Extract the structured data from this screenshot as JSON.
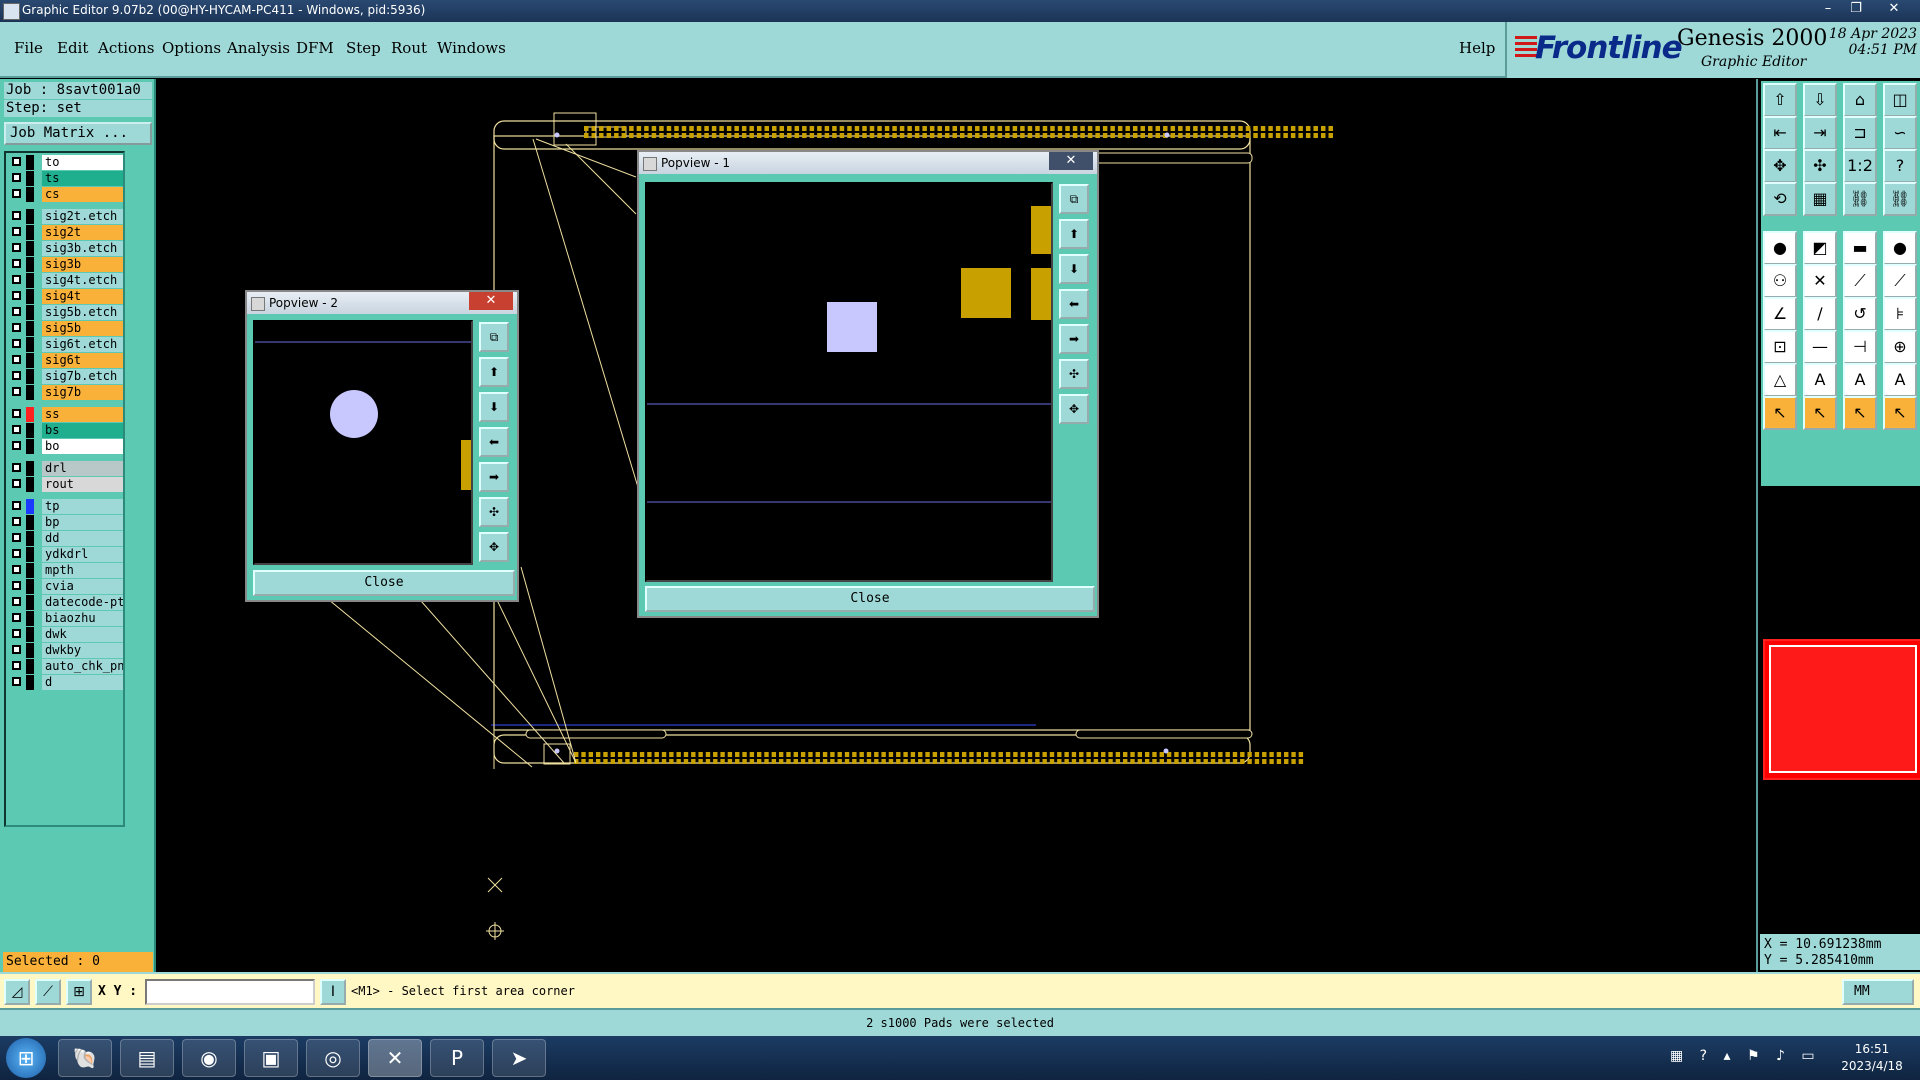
{
  "window": {
    "title": "Graphic Editor 9.07b2 (00@HY-HYCAM-PC411 - Windows, pid:5936)",
    "minimize": "–",
    "restore": "❐",
    "close": "✕"
  },
  "menu": [
    "File",
    "Edit",
    "Actions",
    "Options",
    "Analysis",
    "DFM",
    "Step",
    "Rout",
    "Windows"
  ],
  "help": "Help",
  "brand": {
    "logo": "Frontline",
    "product": "Genesis 2000",
    "subtitle": "Graphic Editor",
    "date": "18 Apr 2023",
    "time": "04:51 PM"
  },
  "job": {
    "label": "Job : 8savt001a0",
    "step": "Step: set",
    "matrix_button": "Job Matrix ..."
  },
  "layers": [
    {
      "name": "to",
      "color": "#ffffff",
      "swatch": "#000000"
    },
    {
      "name": "ts",
      "color": "#1fae8e",
      "swatch": "#000000"
    },
    {
      "name": "cs",
      "color": "#f9b13a",
      "swatch": "#000000"
    },
    {
      "name": "sig2t.etch",
      "color": "#9ed9d8",
      "swatch": "#000000"
    },
    {
      "name": "sig2t",
      "color": "#f9b13a",
      "swatch": "#000000"
    },
    {
      "name": "sig3b.etch",
      "color": "#9ed9d8",
      "swatch": "#000000"
    },
    {
      "name": "sig3b",
      "color": "#f9b13a",
      "swatch": "#000000"
    },
    {
      "name": "sig4t.etch",
      "color": "#9ed9d8",
      "swatch": "#000000"
    },
    {
      "name": "sig4t",
      "color": "#f9b13a",
      "swatch": "#000000"
    },
    {
      "name": "sig5b.etch",
      "color": "#9ed9d8",
      "swatch": "#000000"
    },
    {
      "name": "sig5b",
      "color": "#f9b13a",
      "swatch": "#000000"
    },
    {
      "name": "sig6t.etch",
      "color": "#9ed9d8",
      "swatch": "#000000"
    },
    {
      "name": "sig6t",
      "color": "#f9b13a",
      "swatch": "#000000"
    },
    {
      "name": "sig7b.etch",
      "color": "#9ed9d8",
      "swatch": "#000000"
    },
    {
      "name": "sig7b",
      "color": "#f9b13a",
      "swatch": "#000000"
    },
    {
      "name": "ss",
      "color": "#f9b13a",
      "swatch": "#ff2020"
    },
    {
      "name": "bs",
      "color": "#1fae8e",
      "swatch": "#000000"
    },
    {
      "name": "bo",
      "color": "#ffffff",
      "swatch": "#000000"
    },
    {
      "name": "drl",
      "color": "#b8c8c8",
      "swatch": "#000000"
    },
    {
      "name": "rout",
      "color": "#d8d8d8",
      "swatch": "#000000"
    },
    {
      "name": "tp",
      "color": "#9ed9d8",
      "swatch": "#1a3aff"
    },
    {
      "name": "bp",
      "color": "#9ed9d8",
      "swatch": "#000000"
    },
    {
      "name": "dd",
      "color": "#9ed9d8",
      "swatch": "#000000"
    },
    {
      "name": "ydkdrl",
      "color": "#9ed9d8",
      "swatch": "#000000"
    },
    {
      "name": "mpth",
      "color": "#9ed9d8",
      "swatch": "#000000"
    },
    {
      "name": "cvia",
      "color": "#9ed9d8",
      "swatch": "#000000"
    },
    {
      "name": "datecode-pto",
      "color": "#9ed9d8",
      "swatch": "#000000"
    },
    {
      "name": "biaozhu",
      "color": "#9ed9d8",
      "swatch": "#000000"
    },
    {
      "name": "dwk",
      "color": "#9ed9d8",
      "swatch": "#000000"
    },
    {
      "name": "dwkby",
      "color": "#9ed9d8",
      "swatch": "#000000"
    },
    {
      "name": "auto_chk_pni",
      "color": "#9ed9d8",
      "swatch": "#000000"
    },
    {
      "name": "d",
      "color": "#9ed9d8",
      "swatch": "#000000"
    }
  ],
  "selected": "Selected : 0",
  "coords": {
    "x": "X = 10.691238mm",
    "y": "Y = 5.285410mm"
  },
  "command": {
    "xy_label": "X Y :",
    "xy_value": "",
    "prompt": "<M1> - Select first area corner",
    "unit": "MM"
  },
  "status": "2 s1000 Pads were selected",
  "popview1": {
    "title": "Popview - 1",
    "close": "Close"
  },
  "popview2": {
    "title": "Popview - 2",
    "close": "Close"
  },
  "taskbar": {
    "time": "16:51",
    "date": "2023/4/18"
  },
  "colors": {
    "teal": "#5cc9b3",
    "light_teal": "#9ed9d8",
    "gold": "#c8a000",
    "pad": "#c8c8ff",
    "outline": "#f0e0a0"
  }
}
